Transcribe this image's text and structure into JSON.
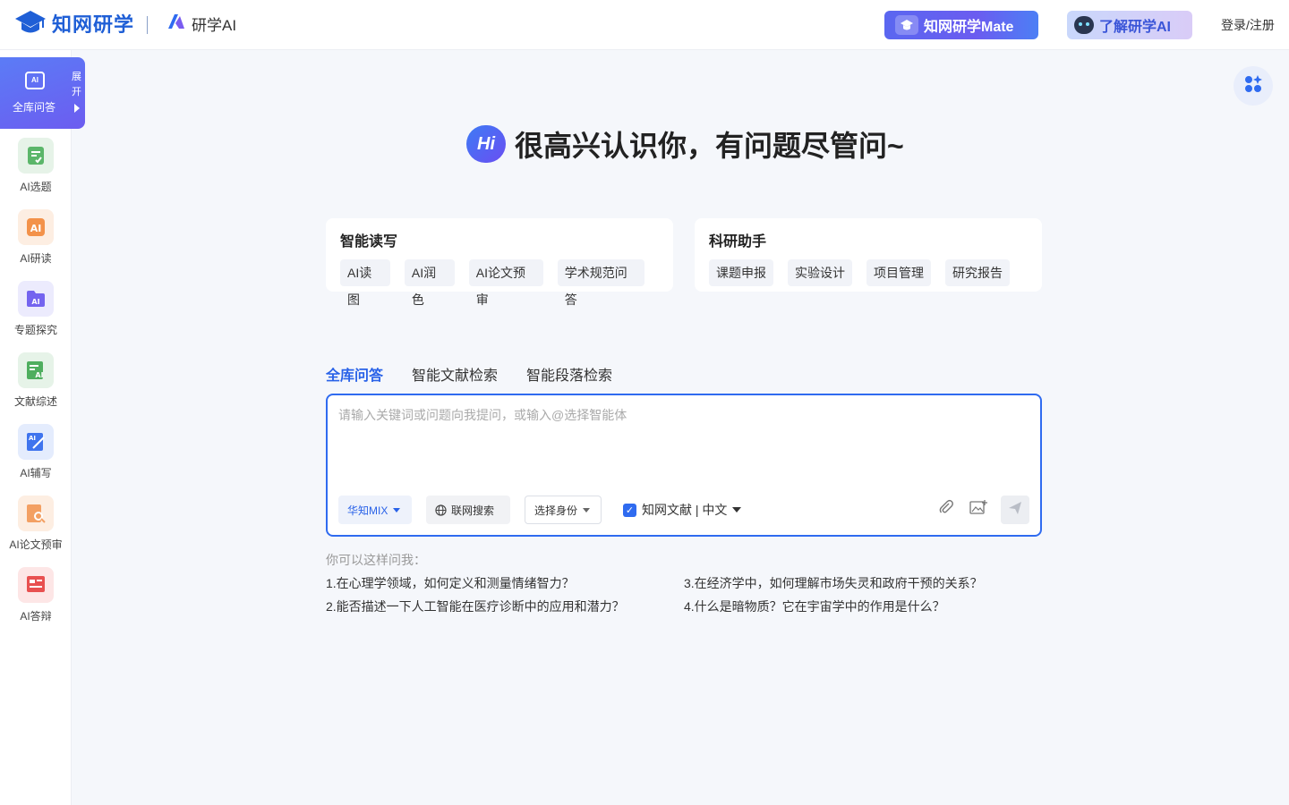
{
  "header": {
    "brand": "知网研学",
    "subbrand": "研学AI",
    "mate_button": "知网研学Mate",
    "learn_button": "了解研学AI",
    "login": "登录/注册"
  },
  "sidebar": {
    "active": {
      "label": "全库问答",
      "expand": "展开"
    },
    "items": [
      {
        "label": "AI选题"
      },
      {
        "label": "AI研读"
      },
      {
        "label": "专题探究"
      },
      {
        "label": "文献综述"
      },
      {
        "label": "AI辅写"
      },
      {
        "label": "AI论文预审"
      },
      {
        "label": "AI答辩"
      }
    ]
  },
  "hero": {
    "badge": "Hi",
    "text": "很高兴认识你，有问题尽管问~"
  },
  "cards": [
    {
      "title": "智能读写",
      "chips": [
        "AI读图",
        "AI润色",
        "AI论文预审",
        "学术规范问答"
      ]
    },
    {
      "title": "科研助手",
      "chips": [
        "课题申报",
        "实验设计",
        "项目管理",
        "研究报告"
      ]
    }
  ],
  "tabs": [
    "全库问答",
    "智能文献检索",
    "智能段落检索"
  ],
  "input": {
    "placeholder": "请输入关键词或问题向我提问，或输入@选择智能体",
    "model": "华知MIX",
    "web_search": "联网搜索",
    "role": "选择身份",
    "source": "知网文献 | 中文"
  },
  "suggestions": {
    "title": "你可以这样问我：",
    "items": [
      "1.在心理学领域，如何定义和测量情绪智力？",
      "2.能否描述一下人工智能在医疗诊断中的应用和潜力？",
      "3.在经济学中，如何理解市场失灵和政府干预的关系？",
      "4.什么是暗物质？它在宇宙学中的作用是什么？"
    ]
  }
}
